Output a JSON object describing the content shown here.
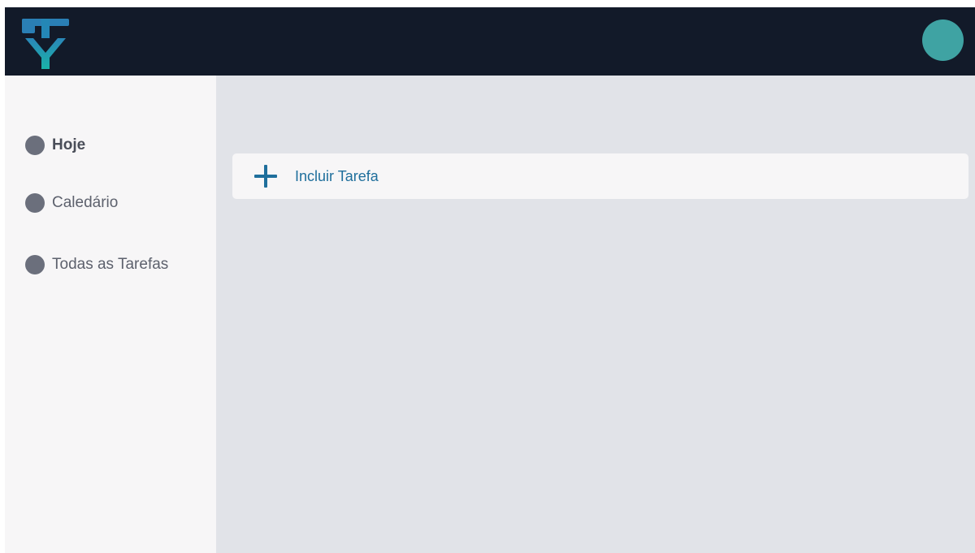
{
  "header": {
    "logo_icon": "ty-logo-icon",
    "avatar_icon": "user-avatar",
    "colors": {
      "background": "#121a29",
      "logo_primary": "#1a9bb0",
      "avatar": "#3fa3a3"
    }
  },
  "sidebar": {
    "items": [
      {
        "label": "Hoje",
        "icon": "dot-icon",
        "active": true
      },
      {
        "label": "Caledário",
        "icon": "dot-icon",
        "active": false
      },
      {
        "label": "Todas as Tarefas",
        "icon": "dot-icon",
        "active": false
      }
    ]
  },
  "main": {
    "add_task": {
      "label": "Incluir Tarefa",
      "icon": "plus-icon",
      "color": "#1f6f9c"
    }
  }
}
